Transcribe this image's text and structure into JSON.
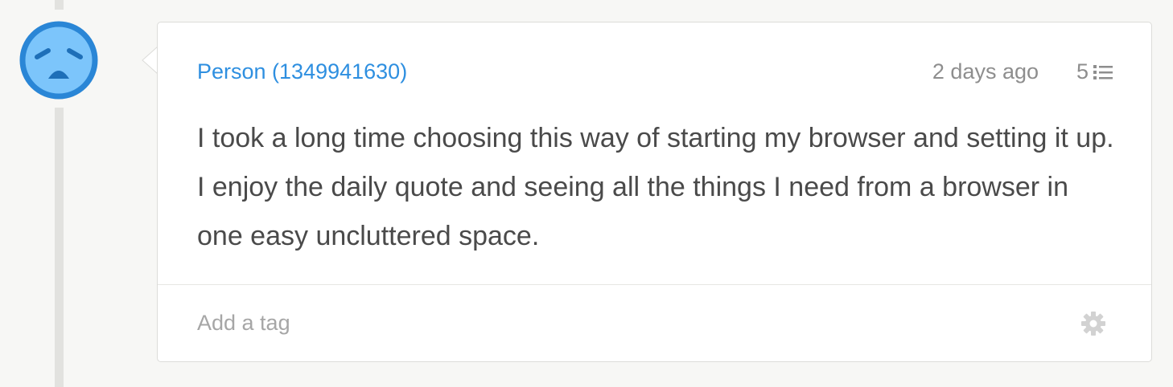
{
  "comment": {
    "author": "Person (1349941630)",
    "timestamp": "2 days ago",
    "reply_count": "5",
    "text": "I took a long time choosing this way of starting my browser and setting it up. I enjoy the daily quote and seeing all the things I need from a browser in one easy uncluttered space.",
    "avatar_icon": "sad-face-icon",
    "avatar_color": "#7cc5fb",
    "avatar_border_color": "#2a86d6"
  },
  "tags": {
    "placeholder": "Add a tag",
    "settings_icon": "gear-icon"
  },
  "colors": {
    "author_link": "#2e8fe0",
    "muted_text": "#8e8e8e",
    "body_text": "#4a4a4a",
    "background": "#f7f7f5"
  }
}
